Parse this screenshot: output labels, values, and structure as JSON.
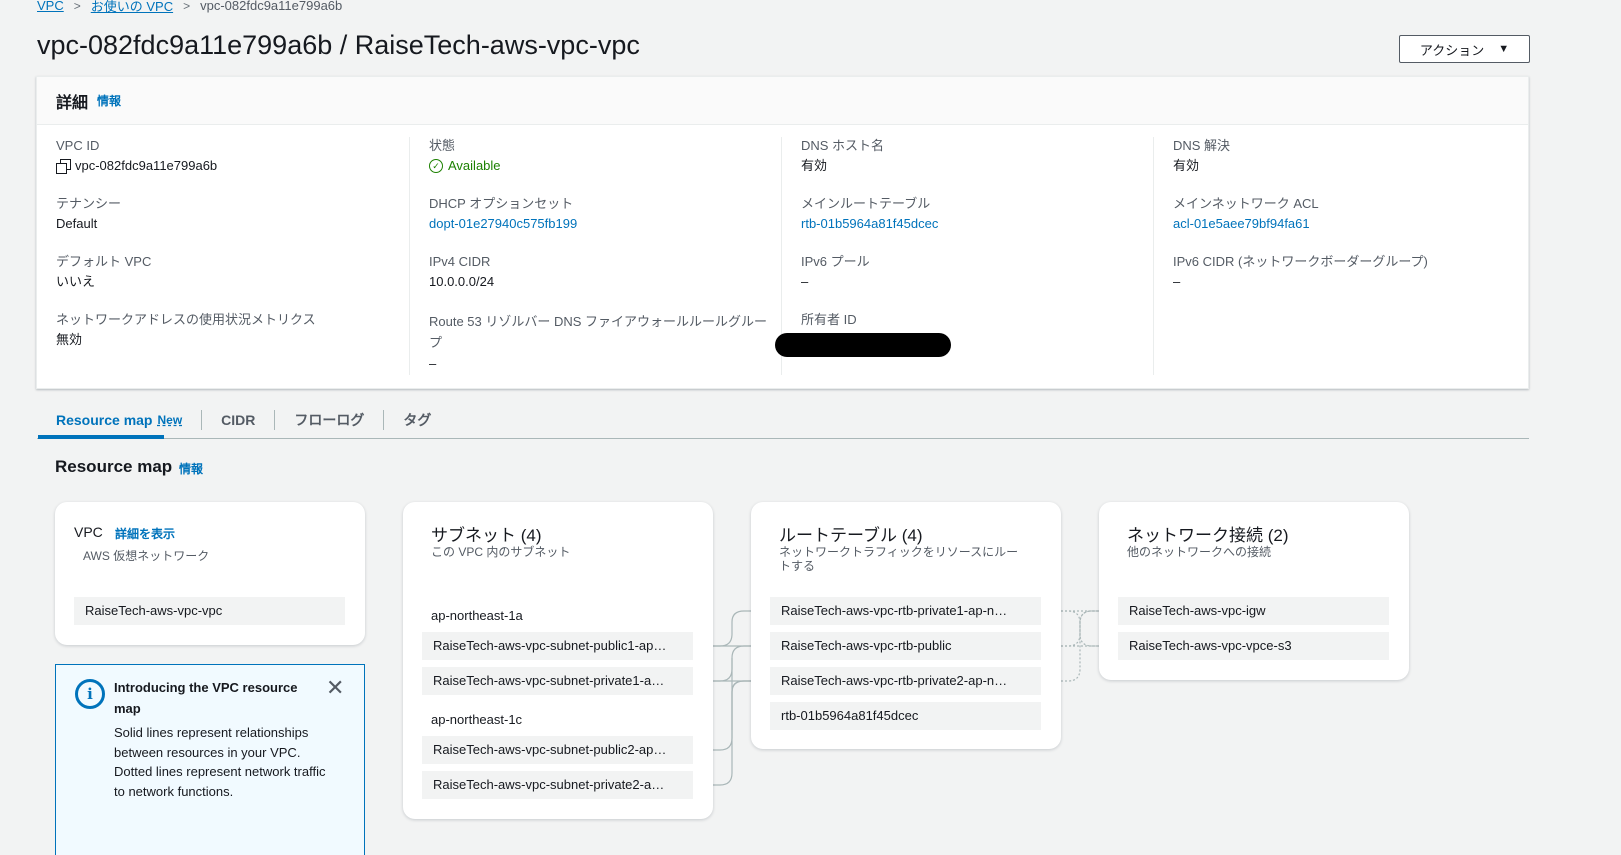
{
  "breadcrumb": {
    "item1": "VPC",
    "item2": "お使いの VPC",
    "current": "vpc-082fdc9a11e799a6b"
  },
  "page_title": "vpc-082fdc9a11e799a6b / RaiseTech-aws-vpc-vpc",
  "action_button": "アクション",
  "details": {
    "title": "詳細",
    "info": "情報",
    "fields": {
      "vpc_id_label": "VPC ID",
      "vpc_id_value": "vpc-082fdc9a11e799a6b",
      "state_label": "状態",
      "state_value": "Available",
      "dns_hostname_label": "DNS ホスト名",
      "dns_hostname_value": "有効",
      "dns_resolution_label": "DNS 解決",
      "dns_resolution_value": "有効",
      "tenancy_label": "テナンシー",
      "tenancy_value": "Default",
      "dhcp_label": "DHCP オプションセット",
      "dhcp_value": "dopt-01e27940c575fb199",
      "main_rt_label": "メインルートテーブル",
      "main_rt_value": "rtb-01b5964a81f45dcec",
      "main_acl_label": "メインネットワーク ACL",
      "main_acl_value": "acl-01e5aee79bf94fa61",
      "default_vpc_label": "デフォルト VPC",
      "default_vpc_value": "いいえ",
      "ipv4_label": "IPv4 CIDR",
      "ipv4_value": "10.0.0.0/24",
      "ipv6_pool_label": "IPv6 プール",
      "ipv6_pool_value": "–",
      "ipv6_cidr_label": "IPv6 CIDR (ネットワークボーダーグループ)",
      "ipv6_cidr_value": "–",
      "metrics_label": "ネットワークアドレスの使用状況メトリクス",
      "metrics_value": "無効",
      "route53_label": "Route 53 リゾルバー DNS ファイアウォールルールグループ",
      "route53_value": "–",
      "owner_label": "所有者 ID"
    }
  },
  "tabs": [
    {
      "label": "Resource map",
      "badge": "New"
    },
    {
      "label": "CIDR"
    },
    {
      "label": "フローログ"
    },
    {
      "label": "タグ"
    }
  ],
  "resource_map": {
    "title": "Resource map",
    "info": "情報",
    "vpc_card": {
      "title": "VPC",
      "link": "詳細を表示",
      "subtitle": "AWS 仮想ネットワーク",
      "item": "RaiseTech-aws-vpc-vpc"
    },
    "subnets_card": {
      "title": "サブネット (4)",
      "subtitle": "この VPC 内のサブネット",
      "az1": "ap-northeast-1a",
      "az1_items": [
        "RaiseTech-aws-vpc-subnet-public1-ap…",
        "RaiseTech-aws-vpc-subnet-private1-a…"
      ],
      "az2": "ap-northeast-1c",
      "az2_items": [
        "RaiseTech-aws-vpc-subnet-public2-ap…",
        "RaiseTech-aws-vpc-subnet-private2-a…"
      ]
    },
    "route_tables_card": {
      "title": "ルートテーブル (4)",
      "subtitle": "ネットワークトラフィックをリソースにルートする",
      "items": [
        "RaiseTech-aws-vpc-rtb-private1-ap-n…",
        "RaiseTech-aws-vpc-rtb-public",
        "RaiseTech-aws-vpc-rtb-private2-ap-n…",
        "rtb-01b5964a81f45dcec"
      ]
    },
    "network_card": {
      "title": "ネットワーク接続 (2)",
      "subtitle": "他のネットワークへの接続",
      "items": [
        "RaiseTech-aws-vpc-igw",
        "RaiseTech-aws-vpc-vpce-s3"
      ]
    },
    "info_box": {
      "title": "Introducing the VPC resource map",
      "body": "Solid lines represent relationships between resources in your VPC. Dotted lines represent network traffic to network functions."
    }
  },
  "colors": {
    "link": "#0073bb",
    "available": "#1d8102",
    "background": "#f2f3f3"
  }
}
